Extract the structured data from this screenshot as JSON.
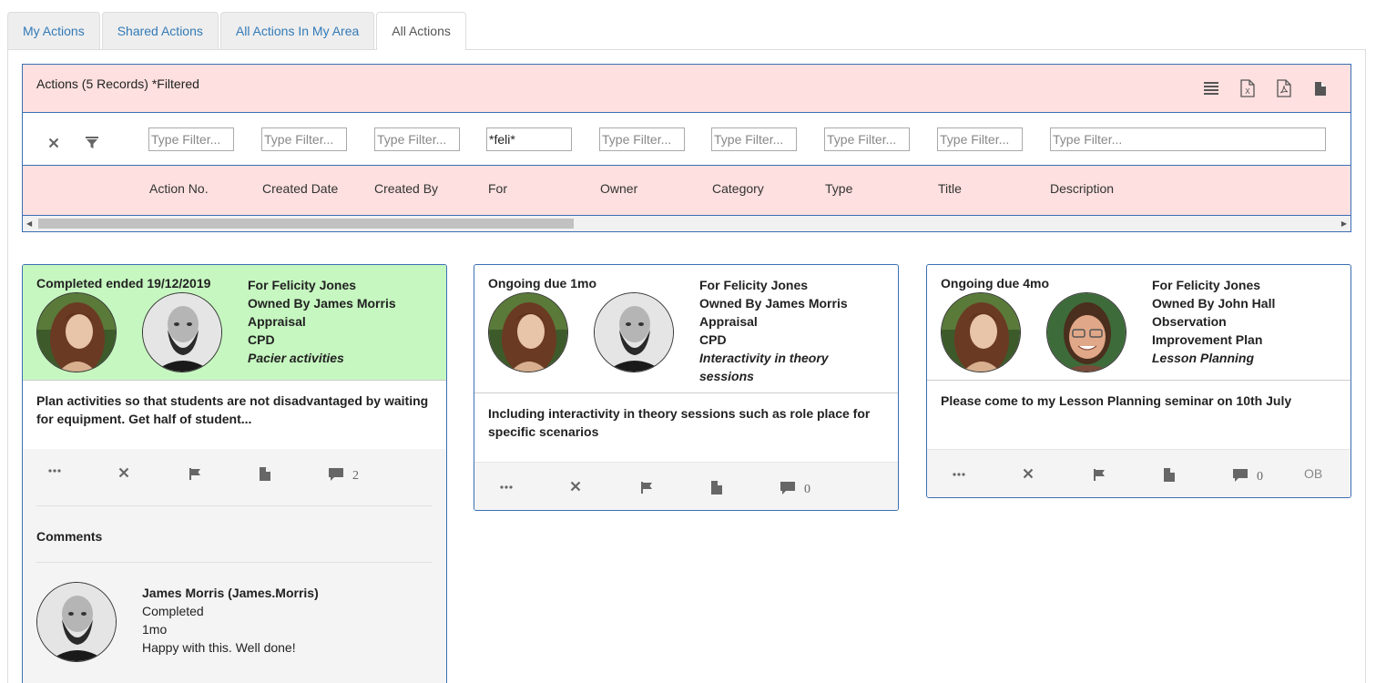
{
  "tabs": [
    {
      "label": "My Actions",
      "active": false
    },
    {
      "label": "Shared Actions",
      "active": false
    },
    {
      "label": "All Actions In My Area",
      "active": false
    },
    {
      "label": "All Actions",
      "active": true
    }
  ],
  "grid": {
    "title": "Actions (5 Records) *Filtered",
    "tools": [
      "list-icon",
      "excel-icon",
      "pdf-icon",
      "file-icon"
    ],
    "filters": {
      "placeholder": "Type Filter...",
      "action_no": "",
      "created_date": "",
      "created_by": "",
      "for": "*feli*",
      "owner": "",
      "category": "",
      "type": "",
      "title": "",
      "description": ""
    },
    "columns": [
      "Action No.",
      "Created Date",
      "Created By",
      "For",
      "Owner",
      "Category",
      "Type",
      "Title",
      "Description"
    ]
  },
  "cards": [
    {
      "status": "Completed ended 19/12/2019",
      "status_color": "#c6f7c0",
      "for": "For Felicity Jones",
      "owner": "Owned By James Morris",
      "line3": "Appraisal",
      "line4": "CPD",
      "title": "Pacier activities",
      "description": "Plan activities so that students are not disadvantaged by waiting for equipment. Get half of student...",
      "comment_count": "2",
      "comments_label": "Comments",
      "comment": {
        "author": "James Morris (James.Morris)",
        "status": "Completed",
        "age": "1mo",
        "text": "Happy with  this. Well done!"
      }
    },
    {
      "status": "Ongoing due 1mo",
      "status_color": "#ffffff",
      "for": "For Felicity Jones",
      "owner": "Owned By James Morris",
      "line3": "Appraisal",
      "line4": "CPD",
      "title": "Interactivity in theory sessions",
      "description": "Including interactivity in theory sessions such as role place for specific scenarios",
      "comment_count": "0"
    },
    {
      "status": "Ongoing due 4mo",
      "status_color": "#ffffff",
      "for": "For Felicity Jones",
      "owner": "Owned By John Hall",
      "line3": "Observation",
      "line4": "Improvement Plan",
      "title": "Lesson Planning",
      "description": "Please come to my Lesson Planning seminar on 10th July",
      "comment_count": "0",
      "extra": "OB"
    }
  ]
}
